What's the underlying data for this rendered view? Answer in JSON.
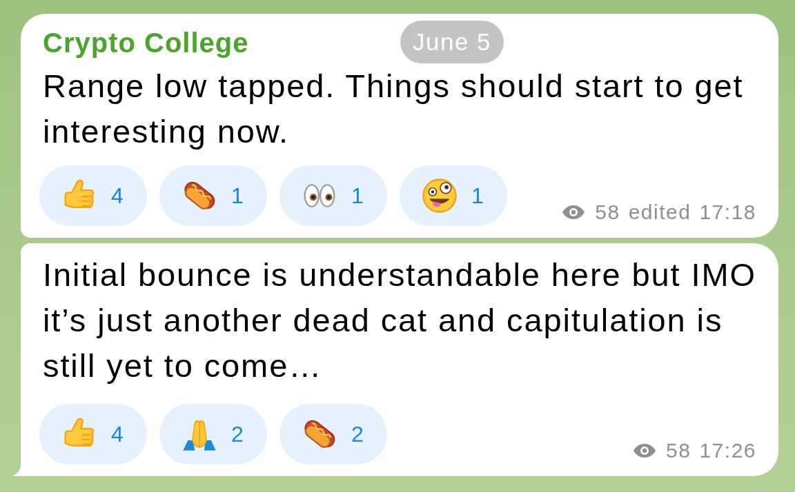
{
  "date_badge": "June 5",
  "messages": [
    {
      "sender": "Crypto College",
      "text": "Range low tapped. Things should start to get interesting now.",
      "reactions": [
        {
          "kind": "thumbsup",
          "count": "4",
          "selected": false
        },
        {
          "kind": "hotdog",
          "count": "1",
          "selected": false
        },
        {
          "kind": "eyes",
          "count": "1",
          "selected": false
        },
        {
          "kind": "zany",
          "count": "1",
          "selected": false
        }
      ],
      "views": "58",
      "edited_label": "edited",
      "time": "17:18",
      "tail": false
    },
    {
      "text": "Initial bounce is understandable here but IMO it’s just another dead cat and capitulation is still yet to come…",
      "reactions": [
        {
          "kind": "thumbsup",
          "count": "4",
          "selected": false
        },
        {
          "kind": "pray",
          "count": "2",
          "selected": false
        },
        {
          "kind": "hotdog",
          "count": "2",
          "selected": false
        }
      ],
      "views": "58",
      "time": "17:26",
      "tail": true
    }
  ]
}
